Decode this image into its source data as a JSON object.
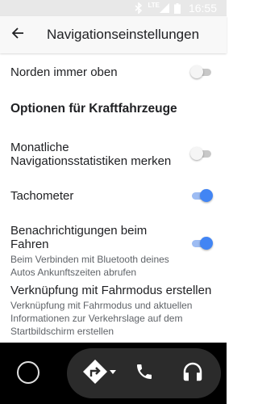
{
  "status_bar": {
    "network": "LTE",
    "time": "16:55",
    "icons": [
      "bluetooth-icon",
      "signal-icon",
      "battery-icon"
    ]
  },
  "app_bar": {
    "back_icon": "arrow-back-icon",
    "title": "Navigationseinstellungen"
  },
  "settings": {
    "north_up": {
      "title": "Norden immer oben",
      "enabled": false
    },
    "section_vehicle": {
      "title": "Optionen für Kraftfahrzeuge"
    },
    "monthly_stats": {
      "title": "Monatliche Navigationsstatistiken merken",
      "enabled": false
    },
    "speedometer": {
      "title": "Tachometer",
      "enabled": true
    },
    "driving_notifications": {
      "title": "Benachrichtigungen beim Fahren",
      "subtitle": "Beim Verbinden mit Bluetooth deines Autos Ankunftszeiten abrufen",
      "enabled": true
    },
    "driving_mode_shortcut": {
      "title": "Verknüpfung mit Fahrmodus erstellen",
      "subtitle": "Verknüpfung mit Fahrmodus und aktuellen Informationen zur Verkehrslage auf dem Startbildschirm erstellen"
    }
  },
  "nav_bar": {
    "items": [
      "home-icon",
      "navigation-icon",
      "phone-icon",
      "headphones-icon"
    ]
  },
  "colors": {
    "accent": "#4285f4",
    "accent_track": "#9dbcf3",
    "nav_background": "#000000",
    "dock_background": "#2b2b2b"
  }
}
